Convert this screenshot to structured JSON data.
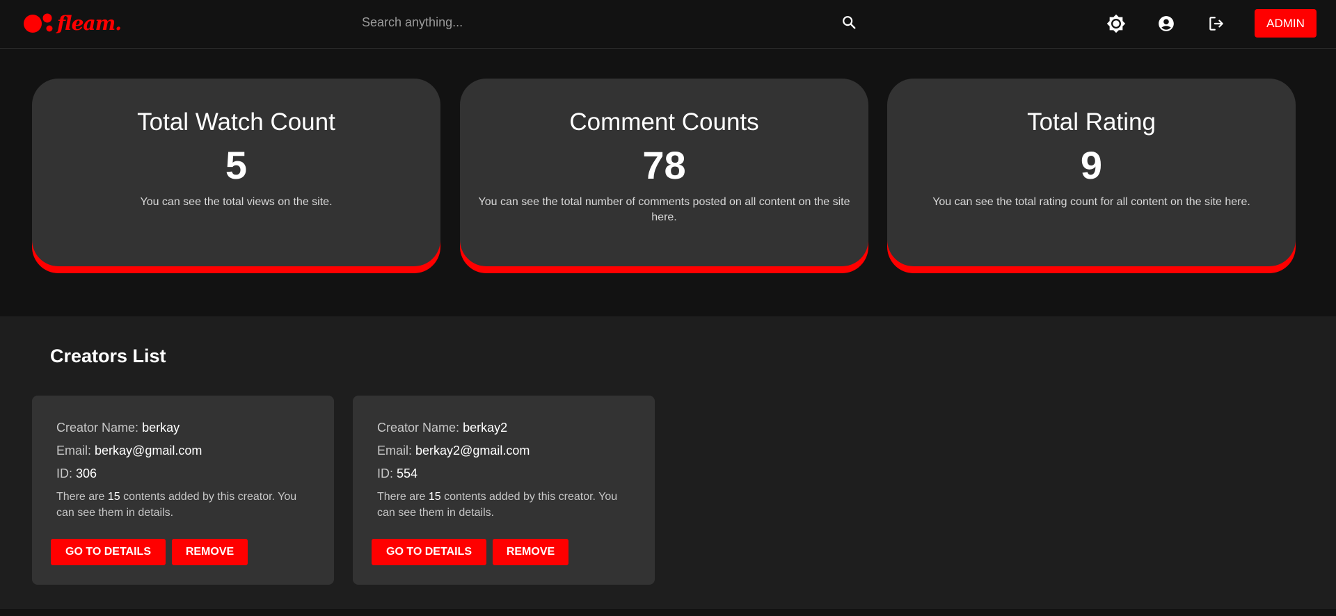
{
  "brand": {
    "name": "fleam.",
    "color": "#ff0000"
  },
  "header": {
    "search": {
      "placeholder": "Search anything..."
    },
    "icons": [
      "theme-toggle-icon",
      "account-icon",
      "logout-icon",
      "search-icon"
    ],
    "admin_label": "ADMIN"
  },
  "stats": [
    {
      "title": "Total Watch Count",
      "value": "5",
      "description": "You can see the total views on the site."
    },
    {
      "title": "Comment Counts",
      "value": "78",
      "description": "You can see the total number of comments posted on all content on the site here."
    },
    {
      "title": "Total Rating",
      "value": "9",
      "description": "You can see the total rating count for all content on the site here."
    }
  ],
  "creators": {
    "title": "Creators List",
    "labels": {
      "name": "Creator Name:",
      "email": "Email:",
      "id": "ID:"
    },
    "items": [
      {
        "name": "berkay",
        "email": "berkay@gmail.com",
        "id": "306",
        "info_prefix": "There are",
        "count": "15",
        "info_suffix": "contents added by this creator. You can see them in details.",
        "details_label": "GO TO DETAILS",
        "remove_label": "REMOVE"
      },
      {
        "name": "berkay2",
        "email": "berkay2@gmail.com",
        "id": "554",
        "info_prefix": "There are",
        "count": "15",
        "info_suffix": "contents added by this creator. You can see them in details.",
        "details_label": "GO TO DETAILS",
        "remove_label": "REMOVE"
      }
    ]
  }
}
